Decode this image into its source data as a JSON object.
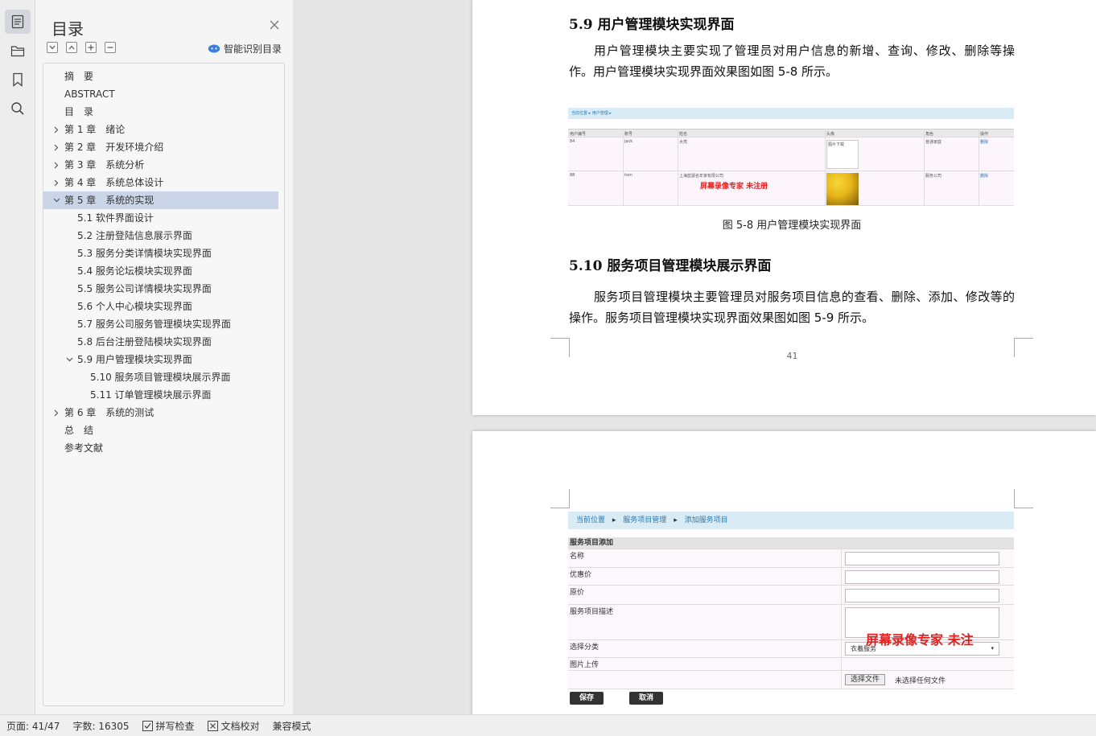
{
  "toc": {
    "title": "目录",
    "smart_toc_label": "智能识别目录",
    "items": [
      {
        "label": "摘　要",
        "level": 0,
        "arrow": "none"
      },
      {
        "label": "ABSTRACT",
        "level": 0,
        "arrow": "none"
      },
      {
        "label": "目　录",
        "level": 0,
        "arrow": "none"
      },
      {
        "label": "第 1 章　绪论",
        "level": 0,
        "arrow": "right"
      },
      {
        "label": "第 2 章　开发环境介绍",
        "level": 0,
        "arrow": "right"
      },
      {
        "label": "第 3 章　系统分析",
        "level": 0,
        "arrow": "right"
      },
      {
        "label": "第 4 章　系统总体设计",
        "level": 0,
        "arrow": "right"
      },
      {
        "label": "第 5 章　系统的实现",
        "level": 0,
        "arrow": "down",
        "active": true
      },
      {
        "label": "5.1  软件界面设计",
        "level": 1,
        "arrow": "none"
      },
      {
        "label": "5.2  注册登陆信息展示界面",
        "level": 1,
        "arrow": "none"
      },
      {
        "label": "5.3  服务分类详情模块实现界面",
        "level": 1,
        "arrow": "none"
      },
      {
        "label": "5.4  服务论坛模块实现界面",
        "level": 1,
        "arrow": "none"
      },
      {
        "label": "5.5 服务公司详情模块实现界面",
        "level": 1,
        "arrow": "none"
      },
      {
        "label": "5.6 个人中心模块实现界面",
        "level": 1,
        "arrow": "none"
      },
      {
        "label": "5.7 服务公司服务管理模块实现界面",
        "level": 1,
        "arrow": "none"
      },
      {
        "label": "5.8  后台注册登陆模块实现界面",
        "level": 1,
        "arrow": "none"
      },
      {
        "label": "5.9  用户管理模块实现界面",
        "level": 1,
        "arrow": "down"
      },
      {
        "label": "5.10  服务项目管理模块展示界面",
        "level": 2,
        "arrow": "none"
      },
      {
        "label": "5.11 订单管理模块展示界面",
        "level": 2,
        "arrow": "none"
      },
      {
        "label": "第 6 章　系统的测试",
        "level": 0,
        "arrow": "right"
      },
      {
        "label": "总　结",
        "level": 0,
        "arrow": "none"
      },
      {
        "label": "参考文献",
        "level": 0,
        "arrow": "none"
      }
    ]
  },
  "doc": {
    "page1": {
      "heading_59": "5.9  用户管理模块实现界面",
      "para_59": "用户管理模块主要实现了管理员对用户信息的新增、查询、修改、删除等操作。用户管理模块实现界面效果图如图 5-8 所示。",
      "fig58": {
        "breadcrumb": "当前位置 ▸ 用户管理 ▸",
        "headers": [
          "用户编号",
          "账号",
          "姓名",
          "头像",
          "角色",
          "操作"
        ],
        "rows": [
          [
            "84",
            "jack",
            "大亮",
            "图片下载",
            "普通家庭",
            "删除"
          ],
          [
            "88",
            "tom",
            "上海蓝瑟名年家有限公司",
            "",
            "服务公司",
            "删除"
          ]
        ]
      },
      "caption_58": "图 5-8  用户管理模块实现界面",
      "heading_510": "5.10  服务项目管理模块展示界面",
      "para_510": "服务项目管理模块主要管理员对服务项目信息的查看、删除、添加、修改等的操作。服务项目管理模块实现界面效果图如图 5-9 所示。",
      "page_number": "41",
      "watermark": "屏幕录像专家  未注册"
    },
    "page2": {
      "fig59": {
        "breadcrumb_1": "当前位置",
        "breadcrumb_2": "服务项目管理",
        "breadcrumb_3": "添加服务项目",
        "section_title": "服务项目添加",
        "label_name": "名称",
        "label_discount": "优惠价",
        "label_price": "原价",
        "label_desc": "服务项目描述",
        "label_category": "选择分类",
        "category_value": "衣着服务",
        "label_upload": "图片上传",
        "choose_file": "选择文件",
        "no_file": "未选择任何文件",
        "save": "保存",
        "cancel": "取消"
      },
      "watermark": "屏幕录像专家  未注"
    }
  },
  "statusbar": {
    "page": "页面: 41/47",
    "words": "字数: 16305",
    "spell": "拼写检查",
    "proof": "文档校对",
    "compat": "兼容模式"
  }
}
